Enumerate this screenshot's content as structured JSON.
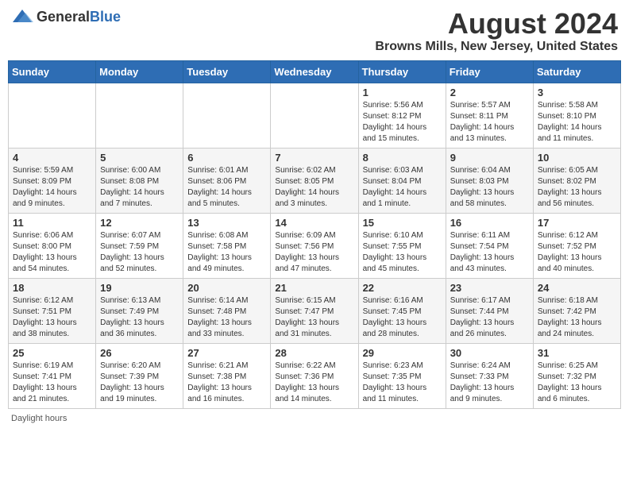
{
  "app": {
    "name_general": "General",
    "name_blue": "Blue"
  },
  "title": "August 2024",
  "subtitle": "Browns Mills, New Jersey, United States",
  "days_of_week": [
    "Sunday",
    "Monday",
    "Tuesday",
    "Wednesday",
    "Thursday",
    "Friday",
    "Saturday"
  ],
  "footer": {
    "label": "Daylight hours"
  },
  "weeks": [
    [
      {
        "date": "",
        "info": ""
      },
      {
        "date": "",
        "info": ""
      },
      {
        "date": "",
        "info": ""
      },
      {
        "date": "",
        "info": ""
      },
      {
        "date": "1",
        "info": "Sunrise: 5:56 AM\nSunset: 8:12 PM\nDaylight: 14 hours and 15 minutes."
      },
      {
        "date": "2",
        "info": "Sunrise: 5:57 AM\nSunset: 8:11 PM\nDaylight: 14 hours and 13 minutes."
      },
      {
        "date": "3",
        "info": "Sunrise: 5:58 AM\nSunset: 8:10 PM\nDaylight: 14 hours and 11 minutes."
      }
    ],
    [
      {
        "date": "4",
        "info": "Sunrise: 5:59 AM\nSunset: 8:09 PM\nDaylight: 14 hours and 9 minutes."
      },
      {
        "date": "5",
        "info": "Sunrise: 6:00 AM\nSunset: 8:08 PM\nDaylight: 14 hours and 7 minutes."
      },
      {
        "date": "6",
        "info": "Sunrise: 6:01 AM\nSunset: 8:06 PM\nDaylight: 14 hours and 5 minutes."
      },
      {
        "date": "7",
        "info": "Sunrise: 6:02 AM\nSunset: 8:05 PM\nDaylight: 14 hours and 3 minutes."
      },
      {
        "date": "8",
        "info": "Sunrise: 6:03 AM\nSunset: 8:04 PM\nDaylight: 14 hours and 1 minute."
      },
      {
        "date": "9",
        "info": "Sunrise: 6:04 AM\nSunset: 8:03 PM\nDaylight: 13 hours and 58 minutes."
      },
      {
        "date": "10",
        "info": "Sunrise: 6:05 AM\nSunset: 8:02 PM\nDaylight: 13 hours and 56 minutes."
      }
    ],
    [
      {
        "date": "11",
        "info": "Sunrise: 6:06 AM\nSunset: 8:00 PM\nDaylight: 13 hours and 54 minutes."
      },
      {
        "date": "12",
        "info": "Sunrise: 6:07 AM\nSunset: 7:59 PM\nDaylight: 13 hours and 52 minutes."
      },
      {
        "date": "13",
        "info": "Sunrise: 6:08 AM\nSunset: 7:58 PM\nDaylight: 13 hours and 49 minutes."
      },
      {
        "date": "14",
        "info": "Sunrise: 6:09 AM\nSunset: 7:56 PM\nDaylight: 13 hours and 47 minutes."
      },
      {
        "date": "15",
        "info": "Sunrise: 6:10 AM\nSunset: 7:55 PM\nDaylight: 13 hours and 45 minutes."
      },
      {
        "date": "16",
        "info": "Sunrise: 6:11 AM\nSunset: 7:54 PM\nDaylight: 13 hours and 43 minutes."
      },
      {
        "date": "17",
        "info": "Sunrise: 6:12 AM\nSunset: 7:52 PM\nDaylight: 13 hours and 40 minutes."
      }
    ],
    [
      {
        "date": "18",
        "info": "Sunrise: 6:12 AM\nSunset: 7:51 PM\nDaylight: 13 hours and 38 minutes."
      },
      {
        "date": "19",
        "info": "Sunrise: 6:13 AM\nSunset: 7:49 PM\nDaylight: 13 hours and 36 minutes."
      },
      {
        "date": "20",
        "info": "Sunrise: 6:14 AM\nSunset: 7:48 PM\nDaylight: 13 hours and 33 minutes."
      },
      {
        "date": "21",
        "info": "Sunrise: 6:15 AM\nSunset: 7:47 PM\nDaylight: 13 hours and 31 minutes."
      },
      {
        "date": "22",
        "info": "Sunrise: 6:16 AM\nSunset: 7:45 PM\nDaylight: 13 hours and 28 minutes."
      },
      {
        "date": "23",
        "info": "Sunrise: 6:17 AM\nSunset: 7:44 PM\nDaylight: 13 hours and 26 minutes."
      },
      {
        "date": "24",
        "info": "Sunrise: 6:18 AM\nSunset: 7:42 PM\nDaylight: 13 hours and 24 minutes."
      }
    ],
    [
      {
        "date": "25",
        "info": "Sunrise: 6:19 AM\nSunset: 7:41 PM\nDaylight: 13 hours and 21 minutes."
      },
      {
        "date": "26",
        "info": "Sunrise: 6:20 AM\nSunset: 7:39 PM\nDaylight: 13 hours and 19 minutes."
      },
      {
        "date": "27",
        "info": "Sunrise: 6:21 AM\nSunset: 7:38 PM\nDaylight: 13 hours and 16 minutes."
      },
      {
        "date": "28",
        "info": "Sunrise: 6:22 AM\nSunset: 7:36 PM\nDaylight: 13 hours and 14 minutes."
      },
      {
        "date": "29",
        "info": "Sunrise: 6:23 AM\nSunset: 7:35 PM\nDaylight: 13 hours and 11 minutes."
      },
      {
        "date": "30",
        "info": "Sunrise: 6:24 AM\nSunset: 7:33 PM\nDaylight: 13 hours and 9 minutes."
      },
      {
        "date": "31",
        "info": "Sunrise: 6:25 AM\nSunset: 7:32 PM\nDaylight: 13 hours and 6 minutes."
      }
    ]
  ]
}
